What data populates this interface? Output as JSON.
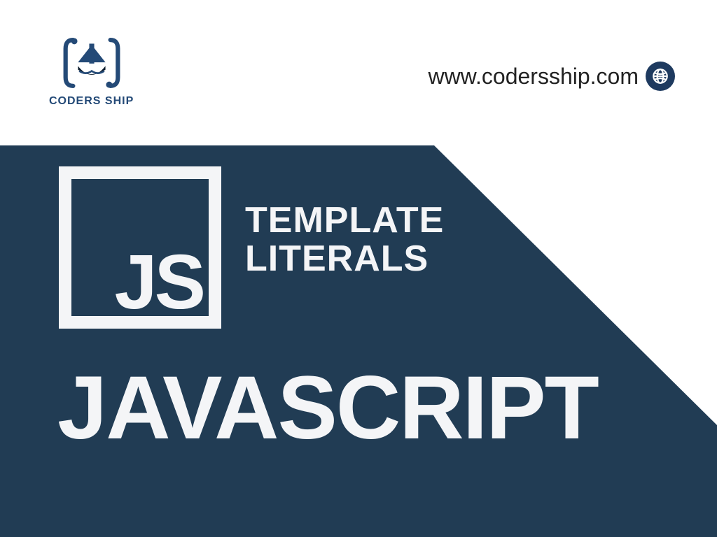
{
  "brand": {
    "name": "CODERS SHIP"
  },
  "url": "www.codersship.com",
  "badge": "JS",
  "topic_line1": "TEMPLATE",
  "topic_line2": "LITERALS",
  "language": "JAVASCRIPT",
  "colors": {
    "navy": "#213c54",
    "light": "#f4f5f7",
    "brand_blue": "#244a77"
  }
}
